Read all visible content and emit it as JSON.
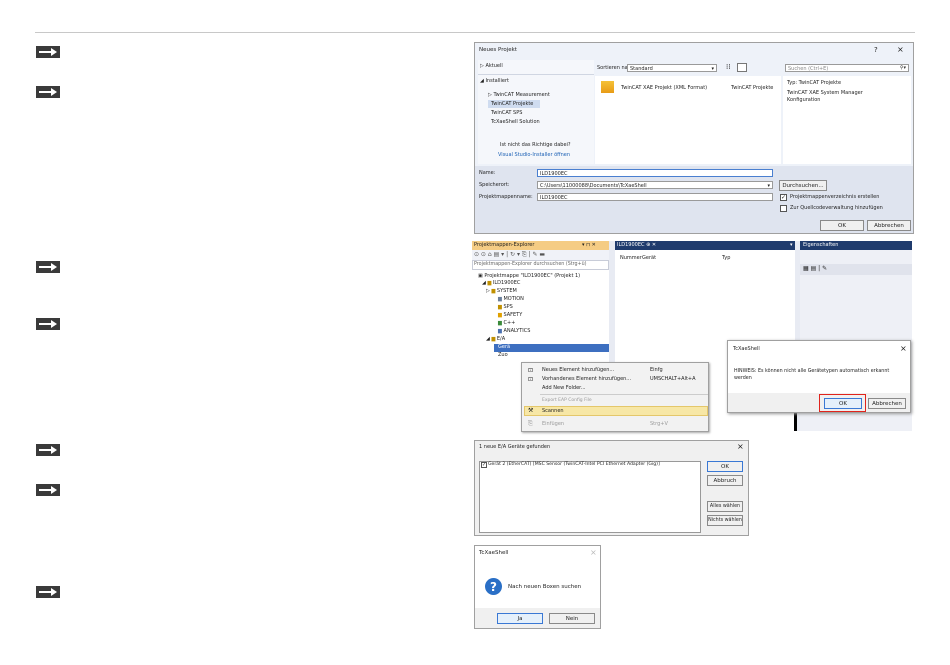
{
  "neues_projekt": {
    "title": "Neues Projekt",
    "help": "?",
    "close": "×",
    "aktuell": "Aktuell",
    "installiert": "Installiert",
    "tree": [
      "TwinCAT Measurement",
      "TwinCAT Projekte",
      "TwinCAT SPS",
      "TcXaeShell Solution"
    ],
    "not_found": "Ist nicht das Richtige dabei?",
    "installer_link": "Visual Studio-Installer öffnen",
    "sort_label": "Sortieren nach:",
    "sort_value": "Standard",
    "search_placeholder": "Suchen (Ctrl+E)",
    "template_name": "TwinCAT XAE Projekt (XML Format)",
    "template_type": "TwinCAT Projekte",
    "typ_label": "Typ:  TwinCAT Projekte",
    "typ_desc1": "TwinCAT XAE System Manager",
    "typ_desc2": "Konfiguration",
    "name_label": "Name:",
    "name_value": "ILD1900EC",
    "speicherort_label": "Speicherort:",
    "speicherort_value": "C:\\Users\\11000088\\Documents\\TcXaeShell",
    "durchsuchen": "Durchsuchen...",
    "pm_label": "Projektmappenname:",
    "pm_value": "ILD1900EC",
    "check1": "Projektmappenverzeichnis erstellen",
    "check2": "Zur Quellcodeverwaltung hinzufügen",
    "ok": "OK",
    "abbrechen": "Abbrechen"
  },
  "explorer": {
    "title": "Projektmappen-Explorer",
    "title_icons": "▾ ⊓ ✕",
    "search": "Projektmappen-Explorer durchsuchen (Strg+ü)",
    "items": [
      "Projektmappe \"ILD1900EC\" (Projekt 1)",
      "ILD1900EC",
      "SYSTEM",
      "MOTION",
      "SPS",
      "SAFETY",
      "C++",
      "ANALYTICS",
      "E/A",
      "Gerä",
      "Zuo"
    ],
    "tab_title": "ILD1900EC",
    "col_nummer": "Nummer",
    "col_geraet": "Gerät",
    "col_typ": "Typ",
    "eigenschaften": "Eigenschaften"
  },
  "context_menu": {
    "items": [
      {
        "label": "Neues Element hinzufügen...",
        "shortcut": "Einfg"
      },
      {
        "label": "Vorhandenes Element hinzufügen...",
        "shortcut": "UMSCHALT+Alt+A"
      },
      {
        "label": "Add New Folder...",
        "shortcut": ""
      },
      {
        "label": "Export EAP Config File",
        "shortcut": ""
      },
      {
        "label": "Scannen",
        "shortcut": ""
      },
      {
        "label": "Einfügen",
        "shortcut": "Strg+V"
      }
    ]
  },
  "tcxae_dialog1": {
    "title": "TcXaeShell",
    "close": "×",
    "message1": "HINWEIS: Es können nicht alle Gerätetypen automatisch erkannt",
    "message2": "werden",
    "ok": "OK",
    "abbrechen": "Abbrechen"
  },
  "ea_dialog": {
    "title": "1 neue E/A Geräte gefunden",
    "close": "×",
    "item": "Gerät 2 (EtherCAT)    [MSC Sensor (TwinCAT-Intel PCI Ethernet Adapter (Gig)]",
    "ok": "OK",
    "abbruch": "Abbruch",
    "alle": "Alles wählen",
    "nichts": "Nichts wählen"
  },
  "tcxae_dialog2": {
    "title": "TcXaeShell",
    "close": "×",
    "question_mark": "?",
    "message": "Nach neuen Boxen suchen",
    "ja": "Ja",
    "nein": "Nein"
  }
}
